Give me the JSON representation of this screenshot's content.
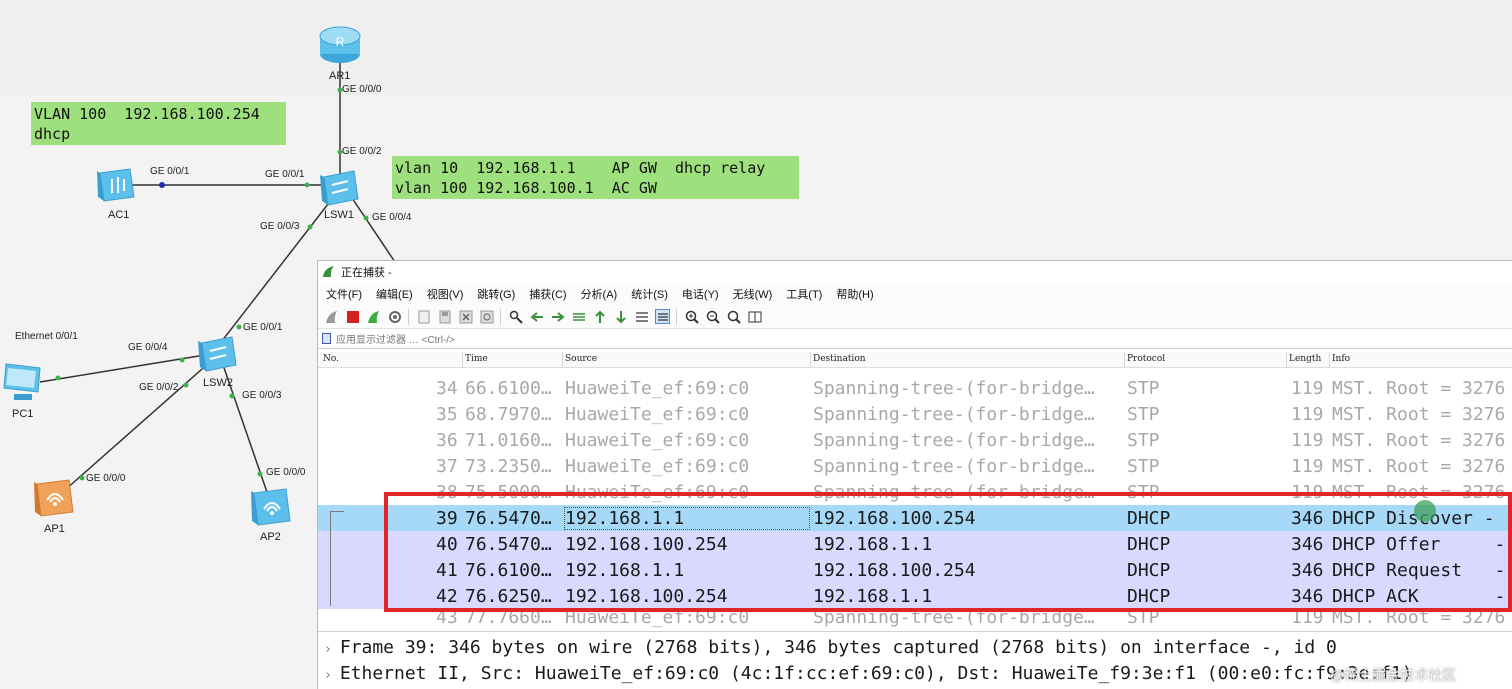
{
  "topology": {
    "devices": {
      "ar1": "AR1",
      "lsw1": "LSW1",
      "lsw2": "LSW2",
      "ac1": "AC1",
      "pc1": "PC1",
      "ap1": "AP1",
      "ap2": "AP2"
    },
    "ports": {
      "ar1_ge000": "GE 0/0/0",
      "lsw1_ge002": "GE 0/0/2",
      "ac1_ge001": "GE 0/0/1",
      "lsw1_ge001": "GE 0/0/1",
      "lsw1_ge004": "GE 0/0/4",
      "lsw1_ge003": "GE 0/0/3",
      "lsw2_ge001": "GE 0/0/1",
      "lsw2_ge004": "GE 0/0/4",
      "lsw2_ge002": "GE 0/0/2",
      "lsw2_ge003": "GE 0/0/3",
      "pc1_eth": "Ethernet 0/0/1",
      "ap1_ge000": "GE 0/0/0",
      "ap2_ge000": "GE 0/0/0"
    },
    "note_ac": {
      "line1": "VLAN 100  192.168.100.254",
      "line2": "dhcp"
    },
    "note_lsw1": {
      "line1": "vlan 10  192.168.1.1    AP GW  dhcp relay",
      "line2": "vlan 100 192.168.100.1  AC GW"
    }
  },
  "wireshark": {
    "title": "正在捕获 -",
    "menu": [
      "文件(F)",
      "编辑(E)",
      "视图(V)",
      "跳转(G)",
      "捕获(C)",
      "分析(A)",
      "统计(S)",
      "电话(Y)",
      "无线(W)",
      "工具(T)",
      "帮助(H)"
    ],
    "filter_placeholder": "应用显示过滤器 … <Ctrl-/>",
    "columns": {
      "no": "No.",
      "time": "Time",
      "source": "Source",
      "destination": "Destination",
      "protocol": "Protocol",
      "length": "Length",
      "info": "Info"
    },
    "packets": [
      {
        "no": "34",
        "time": "66.6100…",
        "src": "HuaweiTe_ef:69:c0",
        "dst": "Spanning-tree-(for-bridge…",
        "proto": "STP",
        "len": "119",
        "info": "MST. Root = 3276"
      },
      {
        "no": "35",
        "time": "68.7970…",
        "src": "HuaweiTe_ef:69:c0",
        "dst": "Spanning-tree-(for-bridge…",
        "proto": "STP",
        "len": "119",
        "info": "MST. Root = 3276"
      },
      {
        "no": "36",
        "time": "71.0160…",
        "src": "HuaweiTe_ef:69:c0",
        "dst": "Spanning-tree-(for-bridge…",
        "proto": "STP",
        "len": "119",
        "info": "MST. Root = 3276"
      },
      {
        "no": "37",
        "time": "73.2350…",
        "src": "HuaweiTe_ef:69:c0",
        "dst": "Spanning-tree-(for-bridge…",
        "proto": "STP",
        "len": "119",
        "info": "MST. Root = 3276"
      },
      {
        "no": "38",
        "time": "75.5000…",
        "src": "HuaweiTe_ef:69:c0",
        "dst": "Spanning-tree-(for-bridge…",
        "proto": "STP",
        "len": "119",
        "info": "MST. Root = 3276"
      },
      {
        "no": "39",
        "time": "76.5470…",
        "src": "192.168.1.1",
        "dst": "192.168.100.254",
        "proto": "DHCP",
        "len": "346",
        "info": "DHCP Discover -"
      },
      {
        "no": "40",
        "time": "76.5470…",
        "src": "192.168.100.254",
        "dst": "192.168.1.1",
        "proto": "DHCP",
        "len": "346",
        "info": "DHCP Offer     -"
      },
      {
        "no": "41",
        "time": "76.6100…",
        "src": "192.168.1.1",
        "dst": "192.168.100.254",
        "proto": "DHCP",
        "len": "346",
        "info": "DHCP Request   -"
      },
      {
        "no": "42",
        "time": "76.6250…",
        "src": "192.168.100.254",
        "dst": "192.168.1.1",
        "proto": "DHCP",
        "len": "346",
        "info": "DHCP ACK       -"
      },
      {
        "no": "43",
        "time": "77.7660…",
        "src": "HuaweiTe_ef:69:c0",
        "dst": "Spanning-tree-(for-bridge…",
        "proto": "STP",
        "len": "119",
        "info": "MST. Root = 3276"
      }
    ],
    "details": {
      "frame": "Frame 39: 346 bytes on wire (2768 bits), 346 bytes captured (2768 bits) on interface -, id 0",
      "ethernet": "Ethernet II, Src: HuaweiTe_ef:69:c0 (4c:1f:cc:ef:69:c0), Dst: HuaweiTe_f9:3e:f1 (00:e0:fc:f9:3e:f1)"
    }
  },
  "watermark": "@稀土掘金技术社区",
  "colors": {
    "note_bg": "#9fe07e",
    "dhcp_row": "#d9d9ff",
    "selected_row": "#a6d9f7",
    "highlight_box": "#e0262b",
    "device_blue": "#5cc0ea"
  }
}
